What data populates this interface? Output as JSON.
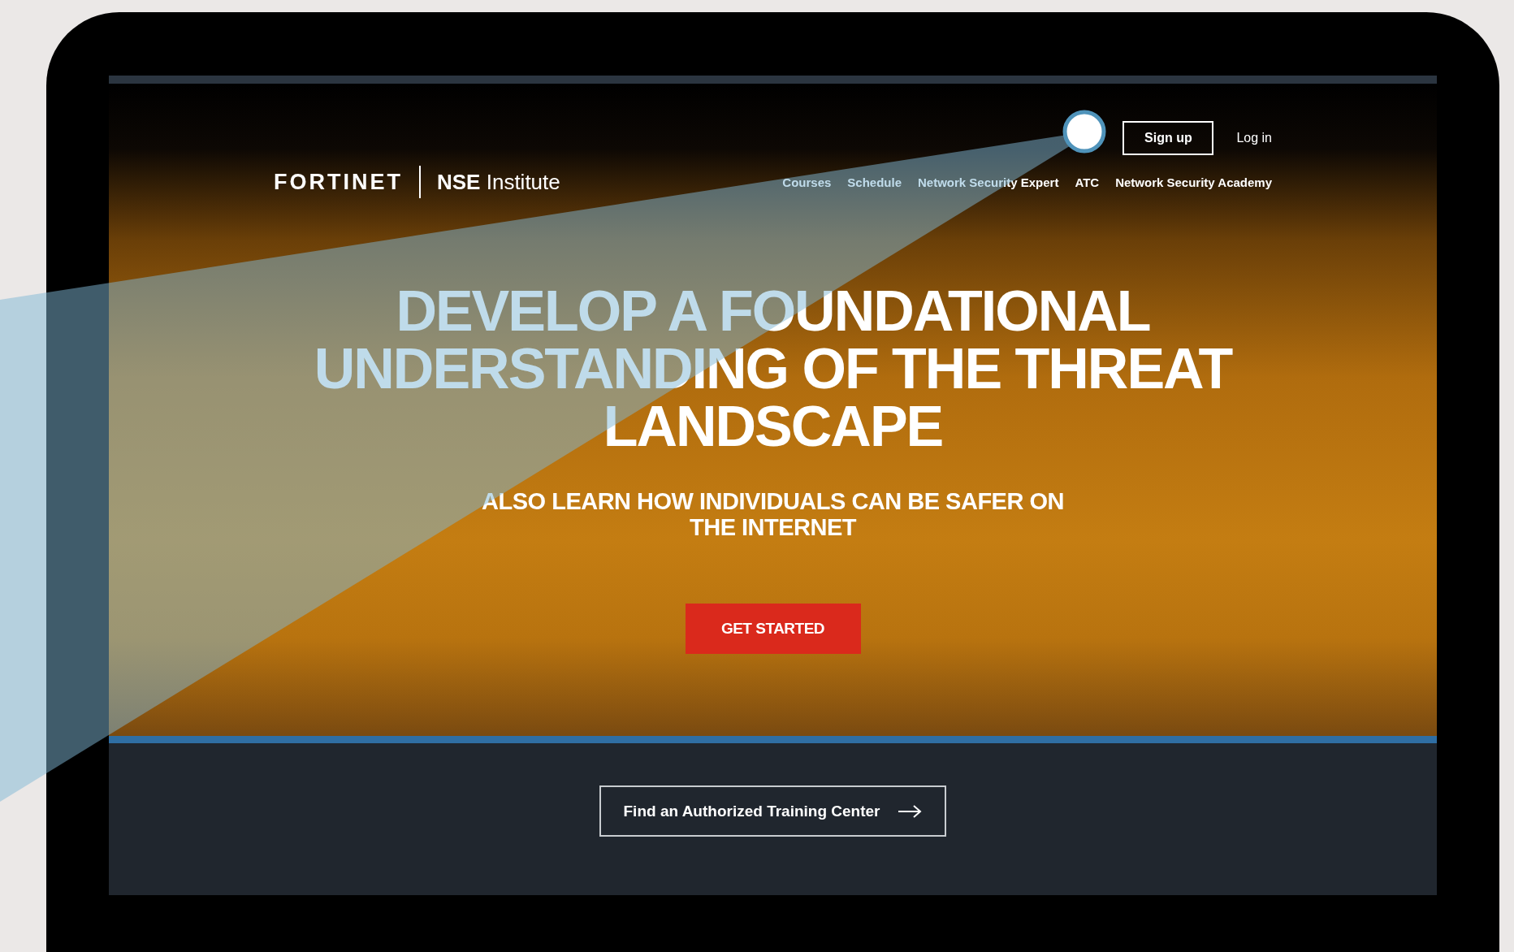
{
  "header": {
    "logo": "FORTINET",
    "product": "**NSE** Institute",
    "signup": "Sign up",
    "login": "Log in",
    "nav": [
      "Courses",
      "Schedule",
      "Network Security Expert",
      "ATC",
      "Network Security Academy"
    ]
  },
  "hero": {
    "headline": "DEVELOP A FOUNDATIONAL UNDERSTANDING OF THE THREAT LANDSCAPE",
    "subtitle": "ALSO LEARN HOW INDIVIDUALS CAN BE SAFER ON THE INTERNET",
    "cta": "GET STARTED"
  },
  "footer": {
    "button": "Find an Authorized Training Center"
  }
}
